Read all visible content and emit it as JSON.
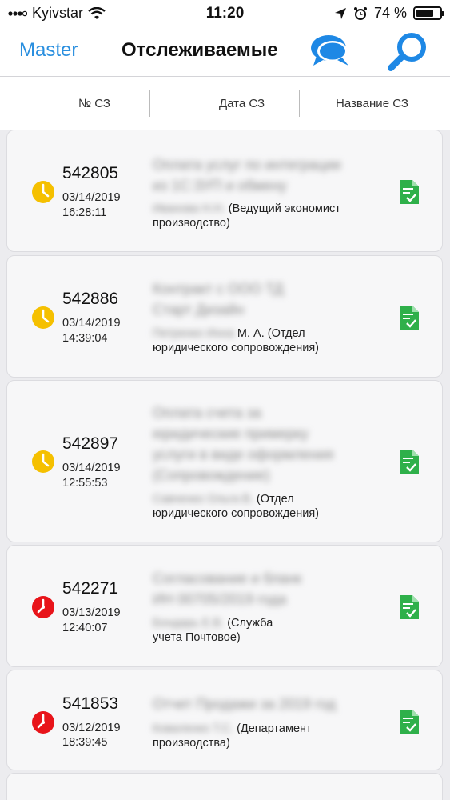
{
  "status_bar": {
    "carrier": "Kyivstar",
    "time": "11:20",
    "battery_percent": "74 %",
    "battery_level": 0.74
  },
  "nav": {
    "back_label": "Master",
    "title": "Отслеживаемые"
  },
  "columns": {
    "number": "№ СЗ",
    "date": "Дата СЗ",
    "name": "Название СЗ"
  },
  "colors": {
    "accent": "#2a8fdf",
    "pending": "#f5c000",
    "overdue": "#e8141a",
    "doc": "#2fb04a"
  },
  "items": [
    {
      "number": "542805",
      "date": "03/14/2019",
      "time": "16:28:11",
      "status": "pending",
      "title_lines": [
        "Оплата услуг по интеграции",
        "из 1С:ЗУП и обмену"
      ],
      "author_hidden": "Иванова Н.Н.",
      "author_visible": "(Ведущий экономист",
      "author_line2": "производство)"
    },
    {
      "number": "542886",
      "date": "03/14/2019",
      "time": "14:39:04",
      "status": "pending",
      "title_lines": [
        "Контракт с ООО ТД",
        "Старт Дизайн"
      ],
      "author_hidden": "Петренко Инна",
      "author_visible": "М. А. (Отдел",
      "author_line2": "юридического сопровождения)"
    },
    {
      "number": "542897",
      "date": "03/14/2019",
      "time": "12:55:53",
      "status": "pending",
      "title_lines": [
        "Оплата счета за",
        "юридические примерку",
        "услуги в виде оформления",
        "(Сопровождение)"
      ],
      "author_hidden": "Савченко Ольга В.",
      "author_visible": "(Отдел",
      "author_line2": "юридического сопровождения)"
    },
    {
      "number": "542271",
      "date": "03/13/2019",
      "time": "12:40:07",
      "status": "overdue",
      "title_lines": [
        "Согласование и бланк",
        "ИН 00705/2019 года"
      ],
      "author_hidden": "Бондарь Е.В.",
      "author_visible": "(Служба",
      "author_line2": "учета Почтовое)"
    },
    {
      "number": "541853",
      "date": "03/12/2019",
      "time": "18:39:45",
      "status": "overdue",
      "title_lines": [
        "Отчет Продажи за 2019 год"
      ],
      "author_hidden": "Коваленко Т.С.",
      "author_visible": "(Департамент",
      "author_line2": "производства)"
    }
  ]
}
